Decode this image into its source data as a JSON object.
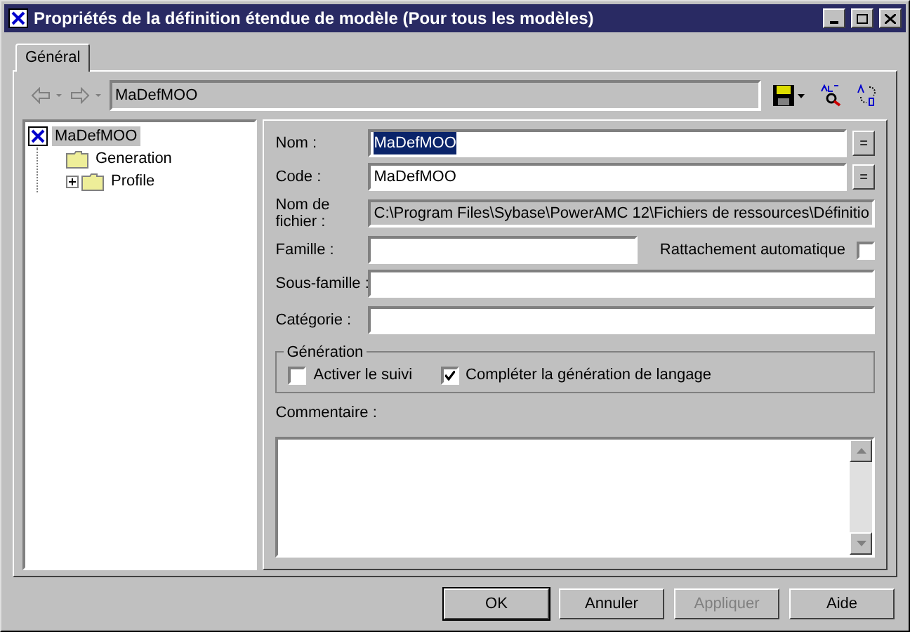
{
  "window": {
    "title": "Propriétés de la définition étendue de modèle (Pour tous les modèles)"
  },
  "tabs": [
    {
      "label": "Général",
      "selected": true
    }
  ],
  "toolbar": {
    "path": "MaDefMOO"
  },
  "tree": [
    {
      "label": "MaDefMOO",
      "kind": "definition",
      "selected": true,
      "expanded": true,
      "children": [
        {
          "label": "Generation",
          "kind": "folder",
          "selected": false
        },
        {
          "label": "Profile",
          "kind": "folder",
          "selected": false,
          "expanded": false
        }
      ]
    }
  ],
  "form": {
    "name": {
      "label": "Nom :",
      "value": "MaDefMOO",
      "selected": true,
      "button": "="
    },
    "code": {
      "label": "Code :",
      "value": "MaDefMOO",
      "button": "="
    },
    "file": {
      "label": "Nom de fichier :",
      "value": "C:\\Program Files\\Sybase\\PowerAMC 12\\Fichiers de ressources\\Définitio",
      "disabled": true
    },
    "family": {
      "label": "Famille :"
    },
    "auto_attach": {
      "label": "Rattachement automatique",
      "checked": false
    },
    "subfamily": {
      "label": "Sous-famille :"
    },
    "category": {
      "label": "Catégorie :"
    },
    "generation": {
      "title": "Génération",
      "options": [
        {
          "label": "Activer le suivi",
          "checked": false
        },
        {
          "label": "Compléter la génération de langage",
          "checked": true
        }
      ]
    },
    "comment": {
      "label": "Commentaire :"
    }
  },
  "buttons": [
    {
      "label": "OK",
      "default": true,
      "disabled": false
    },
    {
      "label": "Annuler",
      "default": false,
      "disabled": false
    },
    {
      "label": "Appliquer",
      "default": false,
      "disabled": true
    },
    {
      "label": "Aide",
      "default": false,
      "disabled": false
    }
  ]
}
